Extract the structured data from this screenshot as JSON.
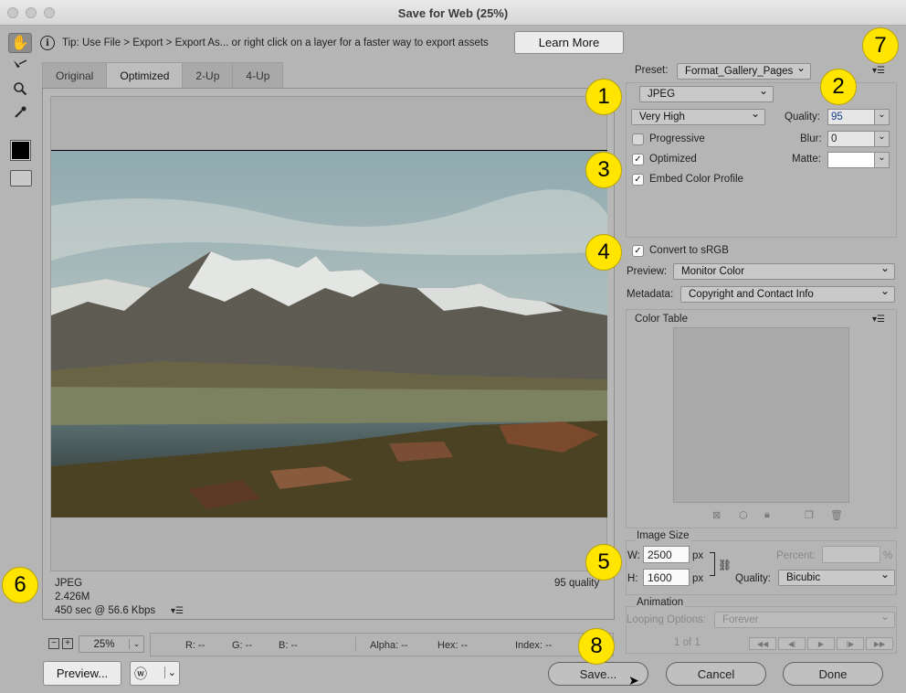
{
  "window": {
    "title": "Save for Web (25%)"
  },
  "tip": {
    "text": "Tip: Use File > Export > Export As...  or right click on a layer for a faster way to export assets",
    "learn_more": "Learn More"
  },
  "tabs": [
    "Original",
    "Optimized",
    "2-Up",
    "4-Up"
  ],
  "preview_info": {
    "format": "JPEG",
    "size": "2.426M",
    "time": "450 sec @ 56.6 Kbps",
    "quality": "95 quality"
  },
  "zoom": {
    "value": "25%"
  },
  "status": {
    "r": "R: --",
    "g": "G: --",
    "b": "B: --",
    "alpha": "Alpha: --",
    "hex": "Hex: --",
    "index": "Index: --"
  },
  "settings": {
    "preset_label": "Preset:",
    "preset_value": "Format_Gallery_Pages",
    "format": "JPEG",
    "compression": "Very High",
    "quality_label": "Quality:",
    "quality_value": "95",
    "progressive": "Progressive",
    "blur_label": "Blur:",
    "blur_value": "0",
    "optimized": "Optimized",
    "matte_label": "Matte:",
    "embed_profile": "Embed Color Profile",
    "convert_srgb": "Convert to sRGB",
    "preview_label": "Preview:",
    "preview_value": "Monitor Color",
    "metadata_label": "Metadata:",
    "metadata_value": "Copyright and Contact Info",
    "color_table": "Color Table"
  },
  "image_size": {
    "title": "Image Size",
    "w_label": "W:",
    "w_value": "2500",
    "h_label": "H:",
    "h_value": "1600",
    "unit": "px",
    "percent_label": "Percent:",
    "percent_unit": "%",
    "quality_label": "Quality:",
    "quality_value": "Bicubic"
  },
  "animation": {
    "title": "Animation",
    "looping_label": "Looping Options:",
    "looping_value": "Forever",
    "frame": "1 of 1"
  },
  "buttons": {
    "preview": "Preview...",
    "save": "Save...",
    "cancel": "Cancel",
    "done": "Done"
  },
  "badges": [
    "1",
    "2",
    "3",
    "4",
    "5",
    "6",
    "7",
    "8"
  ],
  "colors": {
    "badge": "#ffe500",
    "window_bg": "#b5b5b5"
  }
}
